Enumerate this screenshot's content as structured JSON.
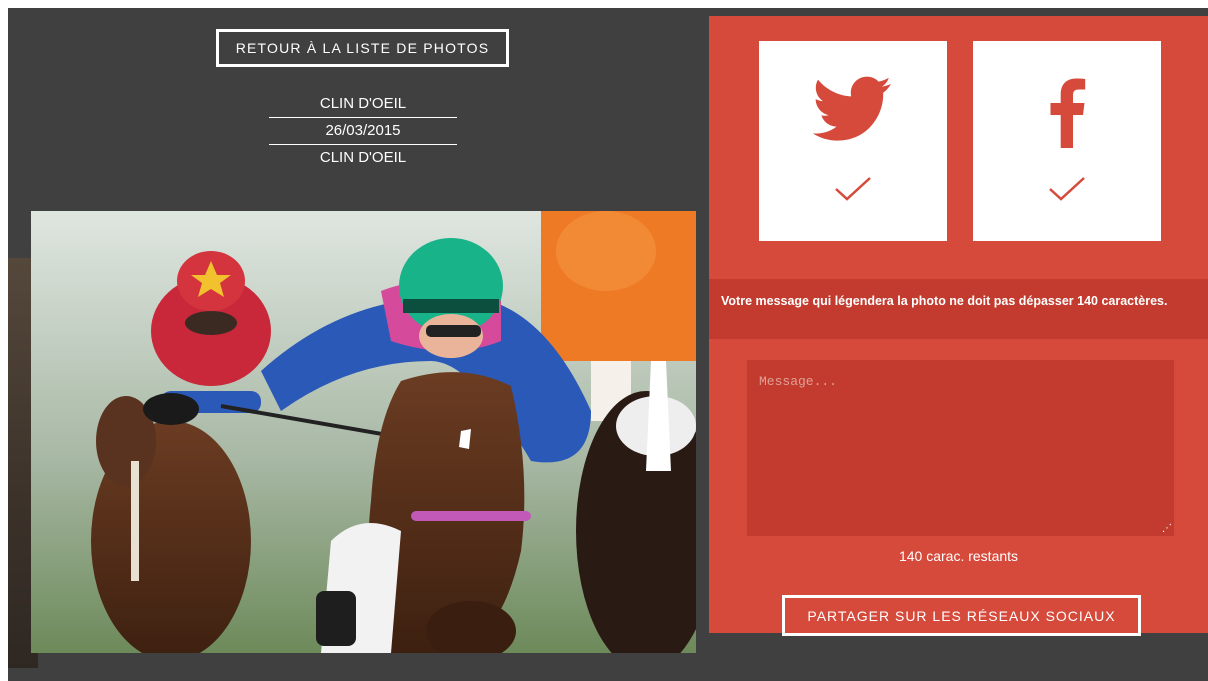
{
  "left_panel": {
    "back_button_label": "RETOUR À LA LISTE DE PHOTOS",
    "photo_title": "CLIN D'OEIL",
    "photo_date": "26/03/2015",
    "photo_category": "CLIN D'OEIL"
  },
  "right_panel": {
    "share_targets": [
      {
        "name": "twitter",
        "icon": "twitter-bird-icon",
        "selected": true
      },
      {
        "name": "facebook",
        "icon": "facebook-f-icon",
        "selected": true
      }
    ],
    "notice": "Votre message qui légendera la photo ne doit pas dépasser 140 caractères.",
    "message_placeholder": "Message...",
    "message_value": "",
    "chars_remaining": "140 carac. restants",
    "share_button_label": "PARTAGER SUR LES RÉSEAUX SOCIAUX"
  },
  "colors": {
    "background": "#404040",
    "accent": "#d64a3b",
    "accent_dark": "#c23b2e",
    "white": "#ffffff"
  }
}
